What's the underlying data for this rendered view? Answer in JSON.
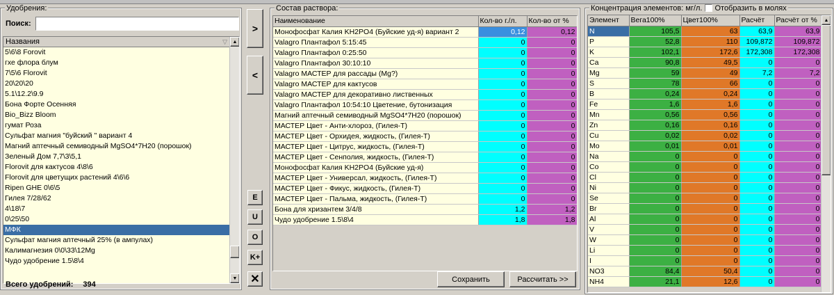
{
  "fertilizers": {
    "title": "Удобрения:",
    "search_label": "Поиск:",
    "search_value": "",
    "column_header": "Названия",
    "items": [
      "5\\6\\8 Forovit",
      "гхе флора блум",
      "7\\5\\6 Florovit",
      "20\\20\\20",
      "5.1\\12.2\\9.9",
      "Бона Форте Осенняя",
      "Bio_Bizz Bloom",
      "гумат Роза",
      "Сульфат магния \"буйский \" вариант 4",
      "Магний аптечный семиводный MgSO4*7H20 (порошок)",
      "Зеленый Дом 7,7\\3\\5,1",
      "Florovit для кактусов 4\\8\\6",
      "Florovit для цветущих растений 4\\6\\6",
      "Ripen GHE 0\\6\\5",
      "Гилея 7/28/62",
      "4\\18\\7",
      "0\\25\\50",
      "МФК",
      "Сульфат магния аптечный 25% (в ампулах)",
      "Калимагнезия 0\\0\\33\\12Mg",
      "Чудо удобрение 1.5\\8\\4"
    ],
    "selected_index": 17,
    "total_label": "Всего удобрений:",
    "total_value": "394"
  },
  "buttons": {
    "add": ">",
    "remove": "<",
    "e": "E",
    "u": "U",
    "o": "O",
    "k_plus": "K+",
    "delete": "✕"
  },
  "solution": {
    "title": "Состав раствора:",
    "headers": [
      "Наименование",
      "Кол-во г./л.",
      "Кол-во от %"
    ],
    "rows": [
      [
        "Монофосфат Калия KH2PO4 (Буйские уд-я) вариант 2",
        "0,12",
        "0,12"
      ],
      [
        "Valagro Плантафол  5:15:45",
        "0",
        "0"
      ],
      [
        "Valagro Плантафол  0:25:50",
        "0",
        "0"
      ],
      [
        "Valagro Плантафол 30:10:10",
        "0",
        "0"
      ],
      [
        "Valagro МАСТЕР для рассады (Mg?)",
        "0",
        "0"
      ],
      [
        "Valagro МАСТЕР для кактусов",
        "0",
        "0"
      ],
      [
        "Valagro МАСТЕР для декоративно лиственных",
        "0",
        "0"
      ],
      [
        "Valagro Плантафол  10:54:10 Цветение, бутонизация",
        "0",
        "0"
      ],
      [
        "Магний аптечный семиводный MgSO4*7H20 (порошок)",
        "0",
        "0"
      ],
      [
        "МАСТЕР Цвет - Анти-хлороз, (Гилея-Т)",
        "0",
        "0"
      ],
      [
        "МАСТЕР Цвет - Орхидея, жидкость,  (Гилея-Т)",
        "0",
        "0"
      ],
      [
        "МАСТЕР Цвет - Цитрус, жидкость,  (Гилея-Т)",
        "0",
        "0"
      ],
      [
        "МАСТЕР Цвет - Сенполия, жидкость,  (Гилея-Т)",
        "0",
        "0"
      ],
      [
        "Монофосфат Калия KH2PO4 (Буйские уд-я)",
        "0",
        "0"
      ],
      [
        "МАСТЕР Цвет - Универсал, жидкость,  (Гилея-Т)",
        "0",
        "0"
      ],
      [
        "МАСТЕР Цвет - Фикус, жидкость,  (Гилея-Т)",
        "0",
        "0"
      ],
      [
        "МАСТЕР Цвет - Пальма, жидкость,  (Гилея-Т)",
        "0",
        "0"
      ],
      [
        "Бона для хризантем 3/4/8",
        "1,2",
        "1,2"
      ],
      [
        "Чудо удобрение 1.5\\8\\4",
        "1,8",
        "1,8"
      ]
    ],
    "save_label": "Сохранить",
    "calc_label": "Рассчитать >>"
  },
  "concentration": {
    "title": "Концентрация элементов: мг/л.",
    "moles_label": "Отобразить в молях",
    "moles_checked": false,
    "headers": [
      "Элемент",
      "Вега100%",
      "Цвет100%",
      "Расчёт",
      "Расчёт от %"
    ],
    "rows": [
      [
        "N",
        "105,5",
        "63",
        "63,9",
        "63,9"
      ],
      [
        "P",
        "52,8",
        "110",
        "109,872",
        "109,872"
      ],
      [
        "K",
        "102,1",
        "172,6",
        "172,308",
        "172,308"
      ],
      [
        "Ca",
        "90,8",
        "49,5",
        "0",
        "0"
      ],
      [
        "Mg",
        "59",
        "49",
        "7,2",
        "7,2"
      ],
      [
        "S",
        "78",
        "66",
        "0",
        "0"
      ],
      [
        "B",
        "0,24",
        "0,24",
        "0",
        "0"
      ],
      [
        "Fe",
        "1,6",
        "1,6",
        "0",
        "0"
      ],
      [
        "Mn",
        "0,56",
        "0,56",
        "0",
        "0"
      ],
      [
        "Zn",
        "0,16",
        "0,16",
        "0",
        "0"
      ],
      [
        "Cu",
        "0,02",
        "0,02",
        "0",
        "0"
      ],
      [
        "Mo",
        "0,01",
        "0,01",
        "0",
        "0"
      ],
      [
        "Na",
        "0",
        "0",
        "0",
        "0"
      ],
      [
        "Co",
        "0",
        "0",
        "0",
        "0"
      ],
      [
        "Cl",
        "0",
        "0",
        "0",
        "0"
      ],
      [
        "Ni",
        "0",
        "0",
        "0",
        "0"
      ],
      [
        "Se",
        "0",
        "0",
        "0",
        "0"
      ],
      [
        "Br",
        "0",
        "0",
        "0",
        "0"
      ],
      [
        "Al",
        "0",
        "0",
        "0",
        "0"
      ],
      [
        "V",
        "0",
        "0",
        "0",
        "0"
      ],
      [
        "W",
        "0",
        "0",
        "0",
        "0"
      ],
      [
        "Li",
        "0",
        "0",
        "0",
        "0"
      ],
      [
        "I",
        "0",
        "0",
        "0",
        "0"
      ],
      [
        "NO3",
        "84,4",
        "50,4",
        "0",
        "0"
      ],
      [
        "NH4",
        "21,1",
        "12,6",
        "0",
        "0"
      ]
    ]
  },
  "colors": {
    "list_bg": "#ffffe1",
    "selection": "#3a6ea5",
    "cyan": "#00ffff",
    "magenta": "#c060c0",
    "green": "#3cb043",
    "orange": "#e07828",
    "blue_cell": "#3a8fdf"
  }
}
